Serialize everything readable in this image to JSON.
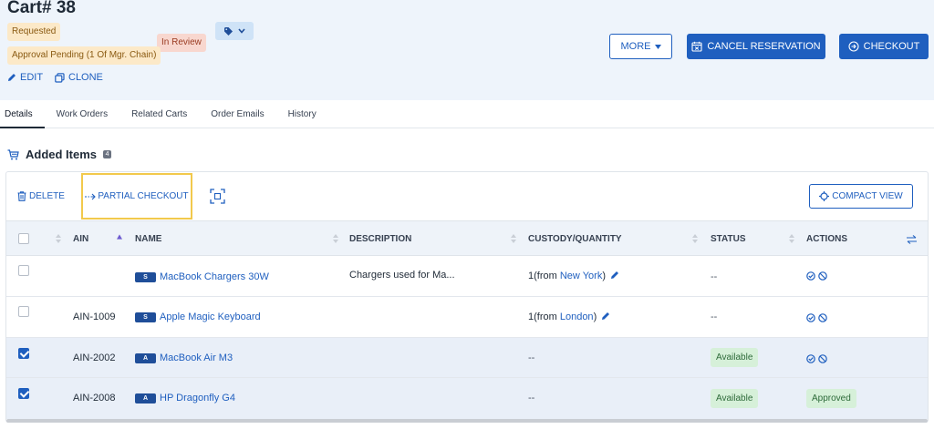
{
  "header": {
    "title": "Cart# 38",
    "badges": {
      "requested": "Requested",
      "in_review": "In Review",
      "approval": "Approval Pending (1 Of Mgr. Chain)"
    },
    "edit_label": "EDIT",
    "clone_label": "CLONE",
    "more_label": "MORE",
    "cancel_label": "CANCEL RESERVATION",
    "checkout_label": "CHECKOUT"
  },
  "tabs": [
    "Details",
    "Work Orders",
    "Related Carts",
    "Order Emails",
    "History"
  ],
  "section": {
    "title": "Added Items",
    "count": "4"
  },
  "toolbar": {
    "delete_label": "DELETE",
    "partial_checkout_label": "PARTIAL CHECKOUT",
    "compact_view_label": "COMPACT VIEW"
  },
  "table": {
    "columns": {
      "ain": "AIN",
      "name": "NAME",
      "description": "DESCRIPTION",
      "custody": "CUSTODY/QUANTITY",
      "status": "STATUS",
      "actions": "ACTIONS"
    },
    "rows": [
      {
        "checked": false,
        "ain": "",
        "type": "S",
        "name": "MacBook Chargers 30W",
        "description": "Chargers used for Ma...",
        "custody_prefix": "1(from",
        "custody_location": "New York",
        "custody_suffix": ")",
        "status": "--",
        "action_text": ""
      },
      {
        "checked": false,
        "ain": "AIN-1009",
        "type": "S",
        "name": "Apple Magic Keyboard",
        "description": "",
        "custody_prefix": "1(from",
        "custody_location": "London",
        "custody_suffix": ")",
        "status": "--",
        "action_text": ""
      },
      {
        "checked": true,
        "ain": "AIN-2002",
        "type": "A",
        "name": "MacBook Air M3",
        "description": "",
        "custody_text": "--",
        "status": "Available",
        "action_text": ""
      },
      {
        "checked": true,
        "ain": "AIN-2008",
        "type": "A",
        "name": "HP Dragonfly G4",
        "description": "",
        "custody_text": "--",
        "status": "Available",
        "action_text": "Approved"
      }
    ]
  },
  "colors": {
    "primary": "#1f5fbf",
    "header_bg": "#eef4fb",
    "highlight_border": "#f2c94c",
    "available_bg": "#d6f0d9"
  }
}
